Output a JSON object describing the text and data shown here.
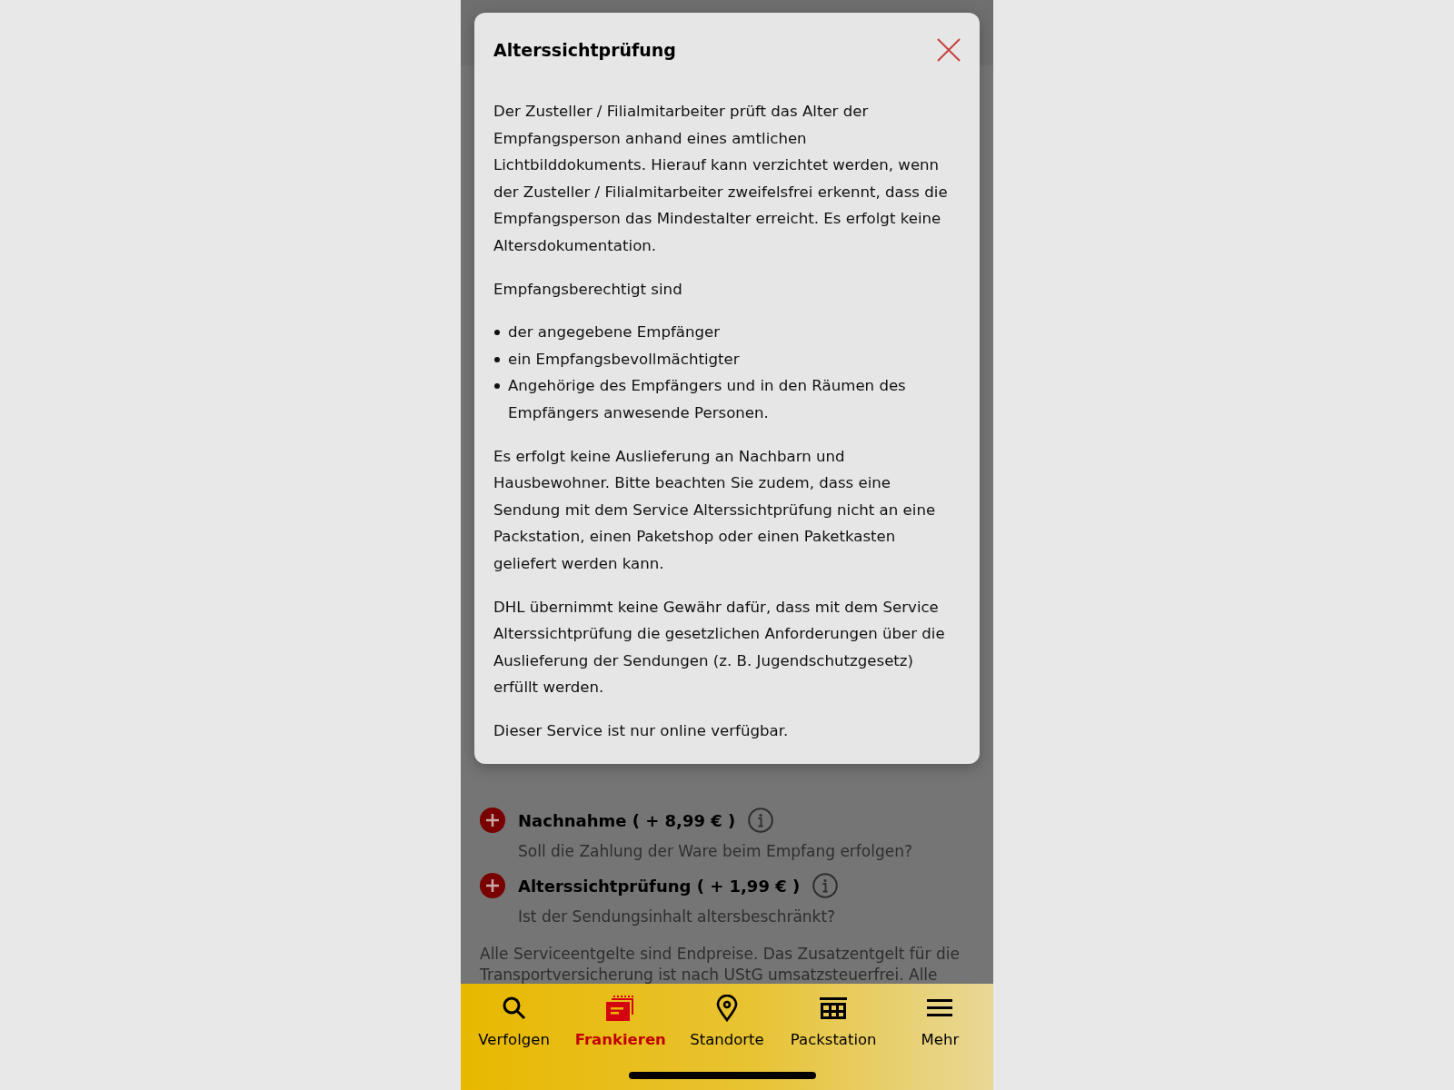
{
  "modal": {
    "title": "Alterssichtprüfung",
    "blocks": [
      {
        "kind": "paragraph",
        "text": "Der Zusteller / Filialmitarbeiter prüft das Alter der Empfangsperson anhand eines amtlichen Lichtbilddokuments. Hierauf kann verzichtet werden, wenn der Zusteller / Filialmitarbeiter zweifelsfrei erkennt, dass die Empfangsperson das Mindestalter erreicht. Es erfolgt keine Altersdokumentation."
      },
      {
        "kind": "paragraph",
        "text": "Empfangsberechtigt sind"
      },
      {
        "kind": "list",
        "items": [
          "der angegebene Empfänger",
          "ein Empfangsbevollmächtigter",
          "Angehörige des Empfängers und in den Räumen des Empfängers anwesende Personen."
        ]
      },
      {
        "kind": "paragraph",
        "text": "Es erfolgt keine Auslieferung an Nachbarn und Hausbewohner. Bitte beachten Sie zudem, dass eine Sendung mit dem Service Alterssichtprüfung nicht an eine Packstation, einen Paketshop oder einen Paketkasten geliefert werden kann."
      },
      {
        "kind": "paragraph",
        "text": "DHL übernimmt keine Gewähr dafür, dass mit dem Service Alterssichtprüfung die gesetzlichen Anforderungen über die Auslieferung der Sendungen (z. B. Jugendschutzgesetz) erfüllt werden."
      },
      {
        "kind": "paragraph",
        "text": "Dieser Service ist nur online verfügbar."
      }
    ]
  },
  "services": [
    {
      "title": "Nachnahme ( + 8,99 € )",
      "subtitle": "Soll die Zahlung der Ware beim Empfang erfolgen?"
    },
    {
      "title": "Alterssichtprüfung ( + 1,99 € )",
      "subtitle": "Ist der Sendungsinhalt altersbeschränkt?"
    }
  ],
  "footnote": "Alle Serviceentgelte sind Endpreise. Das Zusatzentgelt für die Transportversicherung ist nach UStG umsatzsteuerfrei. Alle",
  "tabs": [
    {
      "label": "Verfolgen",
      "selected": false
    },
    {
      "label": "Frankieren",
      "selected": true
    },
    {
      "label": "Standorte",
      "selected": false
    },
    {
      "label": "Packstation",
      "selected": false
    },
    {
      "label": "Mehr",
      "selected": false
    }
  ]
}
